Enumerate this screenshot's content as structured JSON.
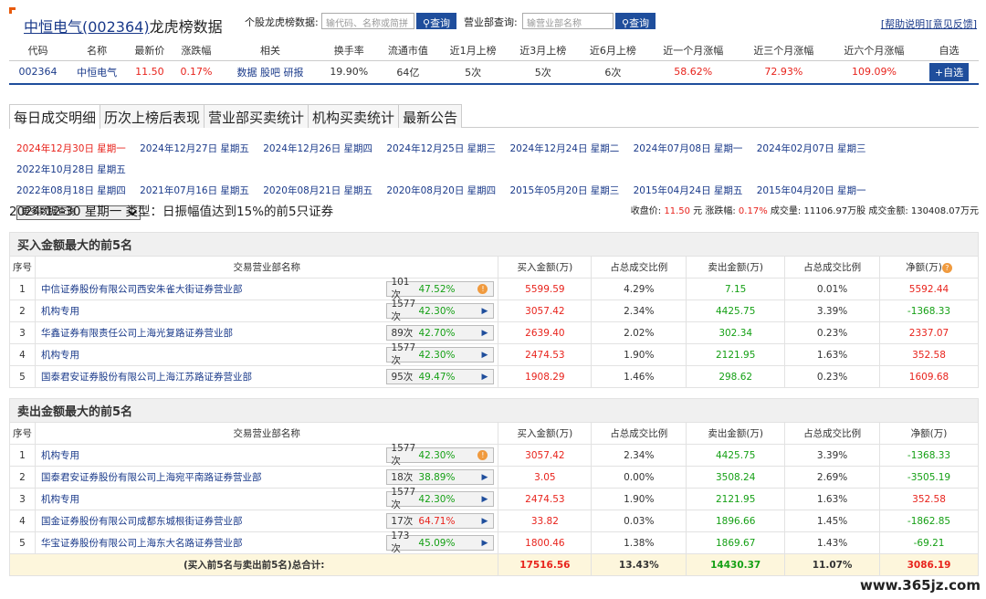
{
  "header": {
    "title_link": "中恒电气(002364)",
    "title_suffix": "龙虎榜数据",
    "stock_query_label": "个股龙虎榜数据:",
    "stock_query_placeholder": "输代码、名称或简拼",
    "query_button": "查询",
    "dept_query_label": "营业部查询:",
    "dept_query_placeholder": "输营业部名称",
    "help_link": "[帮助说明]",
    "feedback_link": "[意见反馈]"
  },
  "stock": {
    "columns": [
      "代码",
      "名称",
      "最新价",
      "涨跌幅",
      "相关",
      "换手率",
      "流通市值",
      "近1月上榜",
      "近3月上榜",
      "近6月上榜",
      "近一个月涨幅",
      "近三个月涨幅",
      "近六个月涨幅",
      "自选"
    ],
    "code": "002364",
    "name": "中恒电气",
    "price": "11.50",
    "change": "0.17%",
    "related": [
      "数据",
      "股吧",
      "研报"
    ],
    "turnover": "19.90%",
    "float_cap": "64亿",
    "m1": "5次",
    "m3": "5次",
    "m6": "6次",
    "g1": "58.62%",
    "g3": "72.93%",
    "g6": "109.09%",
    "add_button": "+自选"
  },
  "tabs": [
    "每日成交明细",
    "历次上榜后表现",
    "营业部买卖统计",
    "机构买卖统计",
    "最新公告"
  ],
  "dates_row1": [
    "2024年12月30日 星期一",
    "2024年12月27日 星期五",
    "2024年12月26日 星期四",
    "2024年12月25日 星期三",
    "2024年12月24日 星期二",
    "2024年07月08日 星期一",
    "2024年02月07日 星期三",
    "2022年10月28日 星期五"
  ],
  "dates_row2": [
    "2022年08月18日 星期四",
    "2021年07月16日 星期五",
    "2020年08月21日 星期五",
    "2020年08月20日 星期四",
    "2015年05月20日 星期三",
    "2015年04月24日 星期五",
    "2015年04月20日 星期一"
  ],
  "more_select": "更多数据查询",
  "summary": {
    "left": "2024-12-30 星期一 类型：日振幅值达到15%的前5只证券",
    "close_label": "收盘价:",
    "close": "11.50",
    "close_unit": "元",
    "chg_label": "涨跌幅:",
    "chg": "0.17%",
    "vol_label": "成交量:",
    "vol": "11106.97万股",
    "amt_label": "成交金额:",
    "amt": "130408.07万元"
  },
  "columns": [
    "序号",
    "交易营业部名称",
    "买入金额(万)",
    "占总成交比例",
    "卖出金额(万)",
    "占总成交比例",
    "净额(万)"
  ],
  "buy_title": "买入金额最大的前5名",
  "sell_title": "卖出金额最大的前5名",
  "buy_rows": [
    {
      "no": "1",
      "name": "中信证券股份有限公司西安朱雀大街证券营业部",
      "cnt": "101次",
      "pct": "47.52%",
      "buy": "5599.59",
      "bp": "4.29%",
      "sell": "7.15",
      "sp": "0.01%",
      "net": "5592.44"
    },
    {
      "no": "2",
      "name": "机构专用",
      "cnt": "1577次",
      "pct": "42.30%",
      "buy": "3057.42",
      "bp": "2.34%",
      "sell": "4425.75",
      "sp": "3.39%",
      "net": "-1368.33"
    },
    {
      "no": "3",
      "name": "华鑫证券有限责任公司上海光复路证券营业部",
      "cnt": "89次",
      "pct": "42.70%",
      "buy": "2639.40",
      "bp": "2.02%",
      "sell": "302.34",
      "sp": "0.23%",
      "net": "2337.07"
    },
    {
      "no": "4",
      "name": "机构专用",
      "cnt": "1577次",
      "pct": "42.30%",
      "buy": "2474.53",
      "bp": "1.90%",
      "sell": "2121.95",
      "sp": "1.63%",
      "net": "352.58"
    },
    {
      "no": "5",
      "name": "国泰君安证券股份有限公司上海江苏路证券营业部",
      "cnt": "95次",
      "pct": "49.47%",
      "buy": "1908.29",
      "bp": "1.46%",
      "sell": "298.62",
      "sp": "0.23%",
      "net": "1609.68"
    }
  ],
  "sell_rows": [
    {
      "no": "1",
      "name": "机构专用",
      "cnt": "1577次",
      "pct": "42.30%",
      "buy": "3057.42",
      "bp": "2.34%",
      "sell": "4425.75",
      "sp": "3.39%",
      "net": "-1368.33"
    },
    {
      "no": "2",
      "name": "国泰君安证券股份有限公司上海宛平南路证券营业部",
      "cnt": "18次",
      "pct": "38.89%",
      "buy": "3.05",
      "bp": "0.00%",
      "sell": "3508.24",
      "sp": "2.69%",
      "net": "-3505.19"
    },
    {
      "no": "3",
      "name": "机构专用",
      "cnt": "1577次",
      "pct": "42.30%",
      "buy": "2474.53",
      "bp": "1.90%",
      "sell": "2121.95",
      "sp": "1.63%",
      "net": "352.58"
    },
    {
      "no": "4",
      "name": "国金证券股份有限公司成都东城根街证券营业部",
      "cnt": "17次",
      "pct": "64.71%",
      "buy": "33.82",
      "bp": "0.03%",
      "sell": "1896.66",
      "sp": "1.45%",
      "net": "-1862.85"
    },
    {
      "no": "5",
      "name": "华宝证券股份有限公司上海东大名路证券营业部",
      "cnt": "173次",
      "pct": "45.09%",
      "buy": "1800.46",
      "bp": "1.38%",
      "sell": "1869.67",
      "sp": "1.43%",
      "net": "-69.21"
    }
  ],
  "total": {
    "label": "(买入前5名与卖出前5名)总合计:",
    "buy": "17516.56",
    "bp": "13.43%",
    "sell": "14430.37",
    "sp": "11.07%",
    "net": "3086.19"
  },
  "watermark": "www.365jz.com"
}
